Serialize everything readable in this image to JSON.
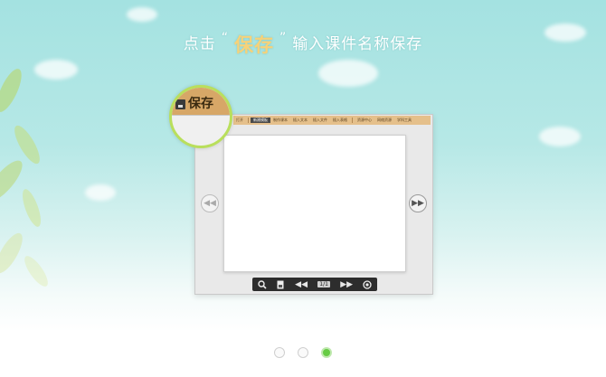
{
  "instruction": {
    "prefix": "点击",
    "open_quote": "“",
    "highlight": "保存",
    "close_quote": "”",
    "suffix": "输入课件名称保存"
  },
  "app": {
    "menu": {
      "items": [
        "打开",
        "新建模板",
        "制作课本",
        "插入文本",
        "插入文件",
        "插入表格",
        "资源中心",
        "网络资源",
        "学科工具"
      ],
      "active_index": 1
    },
    "toolbar": {
      "page_label": "1/1",
      "icons": [
        "search-icon",
        "page-tool-icon",
        "prev-page-icon",
        "page-indicator",
        "next-page-icon",
        "settings-icon"
      ]
    }
  },
  "magnifier": {
    "label": "保存",
    "icon": "save-icon"
  },
  "pagination": {
    "total": 3,
    "active": 3
  },
  "colors": {
    "highlight": "#f6d27a",
    "accent_green": "#66cc44",
    "menu_bg": "#e5c08b",
    "magnifier_ring": "#b9df5c"
  }
}
